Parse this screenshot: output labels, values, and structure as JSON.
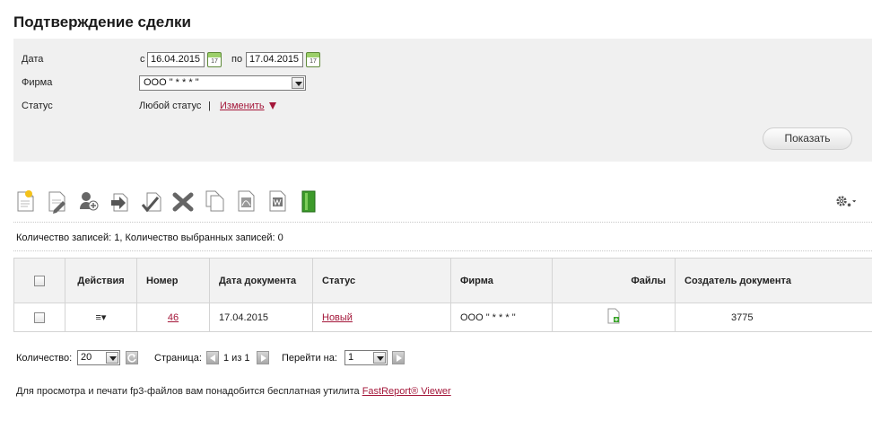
{
  "page": {
    "title": "Подтверждение сделки"
  },
  "filters": {
    "date_label": "Дата",
    "date_from_prefix": "с",
    "date_from": "16.04.2015",
    "date_to_prefix": "по",
    "date_to": "17.04.2015",
    "calendar_day": "17",
    "firm_label": "Фирма",
    "firm_value": "ООО \" * * * \"",
    "status_label": "Статус",
    "status_value": "Любой статус",
    "status_separator": "|",
    "status_change": "Изменить",
    "show_button": "Показать"
  },
  "toolbar": {
    "icons": [
      "new-document-icon",
      "edit-document-icon",
      "assign-user-icon",
      "forward-icon",
      "sign-icon",
      "delete-icon",
      "copy-icon",
      "pdf-export-icon",
      "word-export-icon",
      "archive-icon",
      "settings-gear-icon"
    ]
  },
  "records_info": "Количество записей: 1, Количество выбранных записей: 0",
  "table": {
    "headers": {
      "actions": "Действия",
      "number": "Номер",
      "date": "Дата документа",
      "status": "Статус",
      "firm": "Фирма",
      "files": "Файлы",
      "creator": "Создатель документа"
    },
    "rows": [
      {
        "actions": "≡▾",
        "number": "46",
        "date": "17.04.2015",
        "status": "Новый",
        "firm": "ООО \" * * * \"",
        "creator": "3775"
      }
    ]
  },
  "pager": {
    "count_label": "Количество:",
    "count_value": "20",
    "page_label": "Страница:",
    "page_info": "1 из 1",
    "goto_label": "Перейти на:",
    "goto_value": "1"
  },
  "footer": {
    "note": "Для просмотра и печати fp3-файлов вам понадобится бесплатная утилита",
    "link": "FastReport® Viewer"
  },
  "colors": {
    "link": "#a4173a",
    "panel": "#f0f0f0",
    "header_bg": "#f2f2f2"
  }
}
